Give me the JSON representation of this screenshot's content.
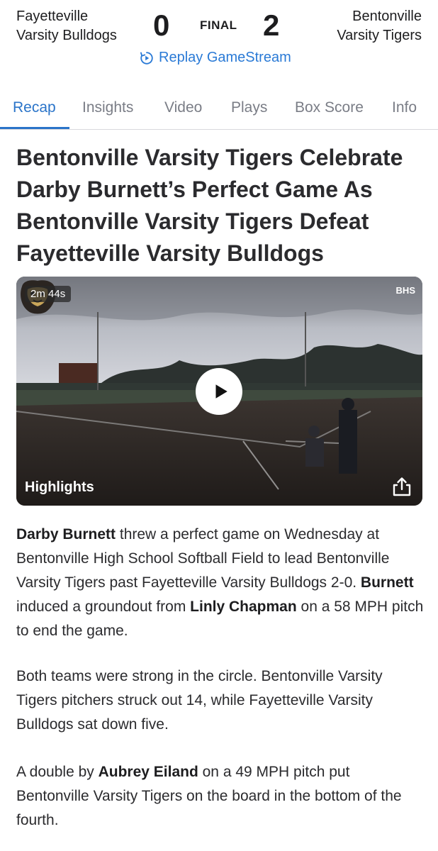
{
  "game": {
    "away_team_line1": "Fayetteville",
    "away_team_line2": "Varsity Bulldogs",
    "away_score": "0",
    "status": "FINAL",
    "home_score": "2",
    "home_team_line1": "Bentonville",
    "home_team_line2": "Varsity Tigers",
    "replay_label": "Replay GameStream"
  },
  "tabs": [
    {
      "label": "Recap",
      "active": true
    },
    {
      "label": "Insights",
      "active": false
    },
    {
      "label": "Video",
      "active": false
    },
    {
      "label": "Plays",
      "active": false
    },
    {
      "label": "Box Score",
      "active": false
    },
    {
      "label": "Info",
      "active": false
    }
  ],
  "headline": "Bentonville Varsity Tigers Celebrate Darby Burnett’s Perfect Game As Bentonville Varsity Tigers Defeat Fayetteville Varsity Bulldogs",
  "video": {
    "duration": "2m 44s",
    "watermark": "BHS",
    "title": "Highlights"
  },
  "recap": {
    "p1": {
      "name1": "Darby Burnett",
      "text1": " threw a perfect game on Wednesday at Bentonville High School Softball Field to lead Bentonville Varsity Tigers past Fayetteville Varsity Bulldogs 2-0. ",
      "name2": "Burnett",
      "text2": " induced a groundout from ",
      "name3": "Linly Chapman",
      "text3": " on a 58 MPH pitch to end the game."
    },
    "p2": "Both teams were strong in the circle. Bentonville Varsity Tigers pitchers struck out 14, while Fayetteville Varsity Bulldogs sat down five.",
    "p3": {
      "text1": "A double by ",
      "name1": "Aubrey Eiland",
      "text2": " on a 49 MPH pitch put Bentonville Varsity Tigers on the board in the bottom of the fourth."
    }
  },
  "colors": {
    "accent": "#2a74c9",
    "replay_link": "#2a7ad6",
    "tab_inactive": "#7a7d86",
    "text": "#2b2b2e"
  },
  "icons": {
    "replay": "replay-circle-icon",
    "play": "play-icon",
    "share": "share-icon",
    "logo": "bulldog-logo-icon"
  }
}
